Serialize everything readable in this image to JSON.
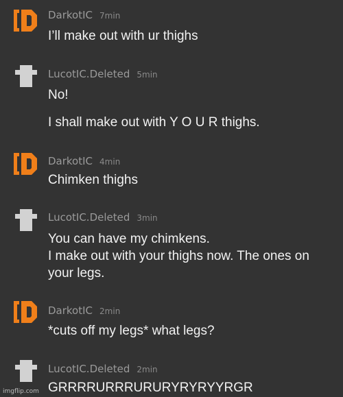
{
  "colors": {
    "background": "#333333",
    "darkot_avatar": "#f07f1a",
    "lucot_avatar": "#d2d2d2",
    "username": "#9a9a9a",
    "message_text": "#f2f2f2"
  },
  "messages": [
    {
      "user": "DarkotIC",
      "time": "7min",
      "avatar_icon": "orange-ic-logo-icon",
      "lines": [
        "I’ll make out with ur thighs"
      ]
    },
    {
      "user": "LucotIC.Deleted",
      "time": "5min",
      "avatar_icon": "deleted-user-shirt-icon",
      "lines": [
        "No!",
        "I shall make out with Y O U R thighs."
      ]
    },
    {
      "user": "DarkotIC",
      "time": "4min",
      "avatar_icon": "orange-ic-logo-icon",
      "lines": [
        "Chimken thighs"
      ]
    },
    {
      "user": "LucotIC.Deleted",
      "time": "3min",
      "avatar_icon": "deleted-user-shirt-icon",
      "lines": [
        "You can have my chimkens.",
        "I make out with your thighs now. The ones on",
        "your legs."
      ]
    },
    {
      "user": "DarkotIC",
      "time": "2min",
      "avatar_icon": "orange-ic-logo-icon",
      "lines": [
        "*cuts off my legs* what legs?"
      ]
    },
    {
      "user": "LucotIC.Deleted",
      "time": "2min",
      "avatar_icon": "deleted-user-shirt-icon",
      "lines": [
        "GRRRRURRRURURYRYRYYRGR"
      ]
    }
  ],
  "watermark": "imgflip.com"
}
